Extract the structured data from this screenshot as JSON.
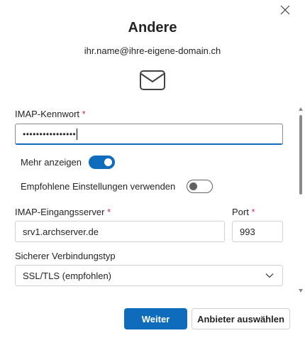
{
  "dialog": {
    "title": "Andere",
    "email": "ihr.name@ihre-eigene-domain.ch",
    "close_icon": "close-icon",
    "mail_icon": "mail-icon"
  },
  "form": {
    "password": {
      "label": "IMAP-Kennwort",
      "required_marker": "*",
      "masked_value": "••••••••••••••••"
    },
    "show_more": {
      "label": "Mehr anzeigen",
      "state": "on"
    },
    "recommended": {
      "label": "Empfohlene Einstellungen verwenden",
      "state": "off"
    },
    "incoming_server": {
      "label": "IMAP-Eingangsserver",
      "required_marker": "*",
      "value": "srv1.archserver.de"
    },
    "port": {
      "label": "Port",
      "required_marker": "*",
      "value": "993"
    },
    "connection_type": {
      "label": "Sicherer Verbindungstyp",
      "selected": "SSL/TLS (empfohlen)",
      "icon": "chevron-down-icon"
    }
  },
  "footer": {
    "primary_label": "Weiter",
    "secondary_label": "Anbieter auswählen"
  },
  "colors": {
    "accent": "#0f6cbd",
    "required": "#c4314b",
    "text": "#242424"
  }
}
